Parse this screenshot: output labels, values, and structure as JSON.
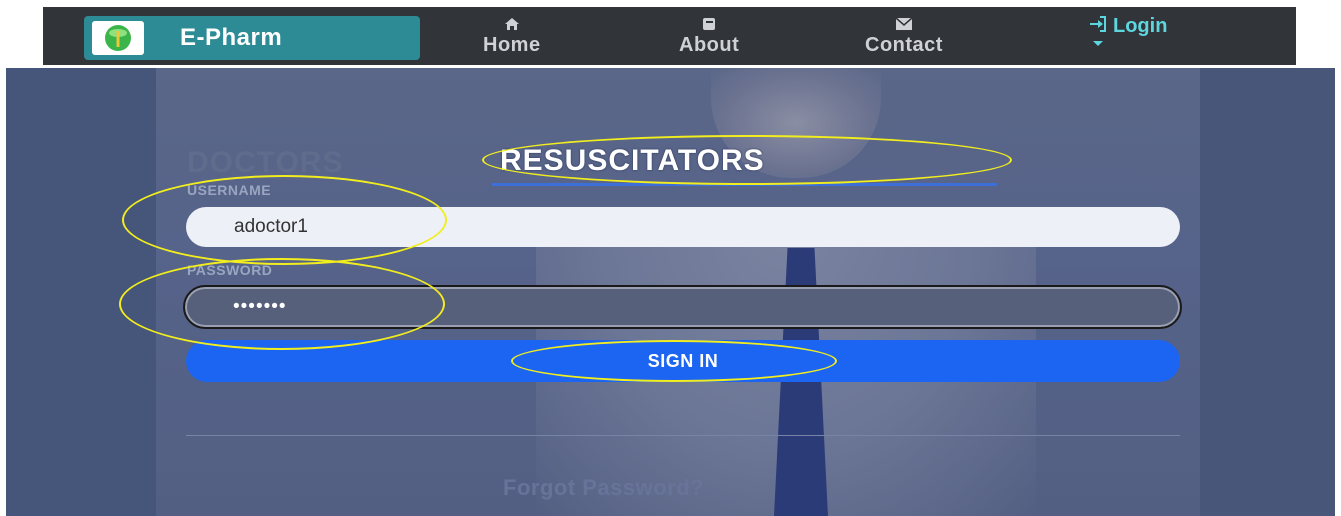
{
  "navbar": {
    "brand": "E-Pharm",
    "items": [
      {
        "label": "Home",
        "icon": "home-icon"
      },
      {
        "label": "About",
        "icon": "book-icon"
      },
      {
        "label": "Contact",
        "icon": "envelope-icon"
      }
    ],
    "login": {
      "label": "Login",
      "icon": "sign-in-icon"
    }
  },
  "form": {
    "tabs": [
      "DOCTORS",
      "RESUSCITATORS"
    ],
    "active_tab": "RESUSCITATORS",
    "username_label": "USERNAME",
    "username_value": "adoctor1",
    "password_label": "PASSWORD",
    "password_value": "•••••••",
    "signin_label": "SIGN IN",
    "forgot_label": "Forgot Password?"
  },
  "colors": {
    "navbar_bg": "#313438",
    "brand_bg": "#2d8b96",
    "login_accent": "#5ed6df",
    "button_bg": "#1c64f2",
    "annotation": "#f2ee1e"
  }
}
